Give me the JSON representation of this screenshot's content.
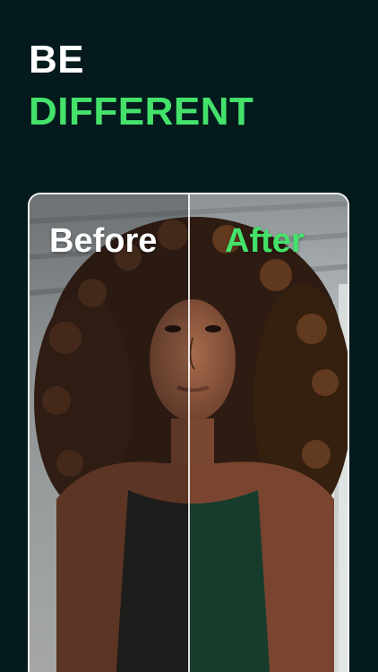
{
  "headline": {
    "line1": "BE",
    "line2": "DIFFERENT"
  },
  "comparison": {
    "before_label": "Before",
    "after_label": "After",
    "image_description_icon": "portrait-photo"
  },
  "colors": {
    "background": "#041a1c",
    "accent_green": "#44e26a",
    "text_white": "#ffffff",
    "card_border": "#f2f2f2"
  }
}
